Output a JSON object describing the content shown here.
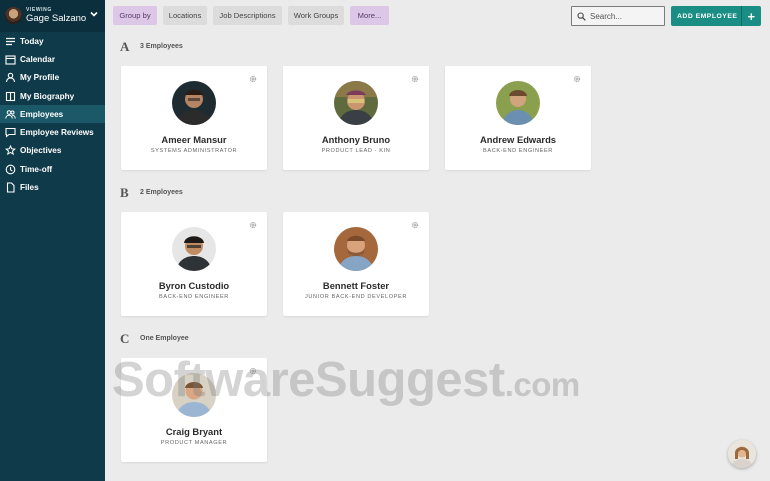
{
  "sidebar": {
    "viewing_label": "VIEWING",
    "user_name": "Gage Salzano",
    "items": [
      {
        "label": "Today",
        "icon": "list-icon",
        "active": false
      },
      {
        "label": "Calendar",
        "icon": "calendar-icon",
        "active": false
      },
      {
        "label": "My Profile",
        "icon": "user-icon",
        "active": false
      },
      {
        "label": "My Biography",
        "icon": "book-icon",
        "active": false
      },
      {
        "label": "Employees",
        "icon": "users-icon",
        "active": true
      },
      {
        "label": "Employee Reviews",
        "icon": "speech-bubble-icon",
        "active": false
      },
      {
        "label": "Objectives",
        "icon": "star-icon",
        "active": false
      },
      {
        "label": "Time-off",
        "icon": "clock-icon",
        "active": false
      },
      {
        "label": "Files",
        "icon": "file-icon",
        "active": false
      }
    ]
  },
  "toolbar": {
    "chips": [
      "Group by",
      "Locations",
      "Job Descriptions",
      "Work Groups",
      "More..."
    ],
    "search_placeholder": "Search...",
    "add_employee_label": "ADD EMPLOYEE",
    "add_plus": "+"
  },
  "groups": [
    {
      "letter": "A",
      "count": "3 Employees",
      "employees": [
        {
          "name": "Ameer Mansur",
          "role": "SYSTEMS ADMINISTRATOR"
        },
        {
          "name": "Anthony Bruno",
          "role": "PRODUCT LEAD - KIN"
        },
        {
          "name": "Andrew Edwards",
          "role": "BACK-END ENGINEER"
        }
      ]
    },
    {
      "letter": "B",
      "count": "2 Employees",
      "employees": [
        {
          "name": "Byron Custodio",
          "role": "BACK-END ENGINEER"
        },
        {
          "name": "Bennett Foster",
          "role": "JUNIOR BACK-END DEVELOPER"
        }
      ]
    },
    {
      "letter": "C",
      "count": "One Employee",
      "employees": [
        {
          "name": "Craig Bryant",
          "role": "PRODUCT MANAGER"
        }
      ]
    }
  ],
  "watermark": {
    "main": "SoftwareSuggest",
    "suffix": ".com"
  },
  "colors": {
    "sidebar": "#0f3a4a",
    "sidebar_active": "#1b5969",
    "accent": "#1a8e85",
    "chip_purple": "#dcc7e6"
  }
}
